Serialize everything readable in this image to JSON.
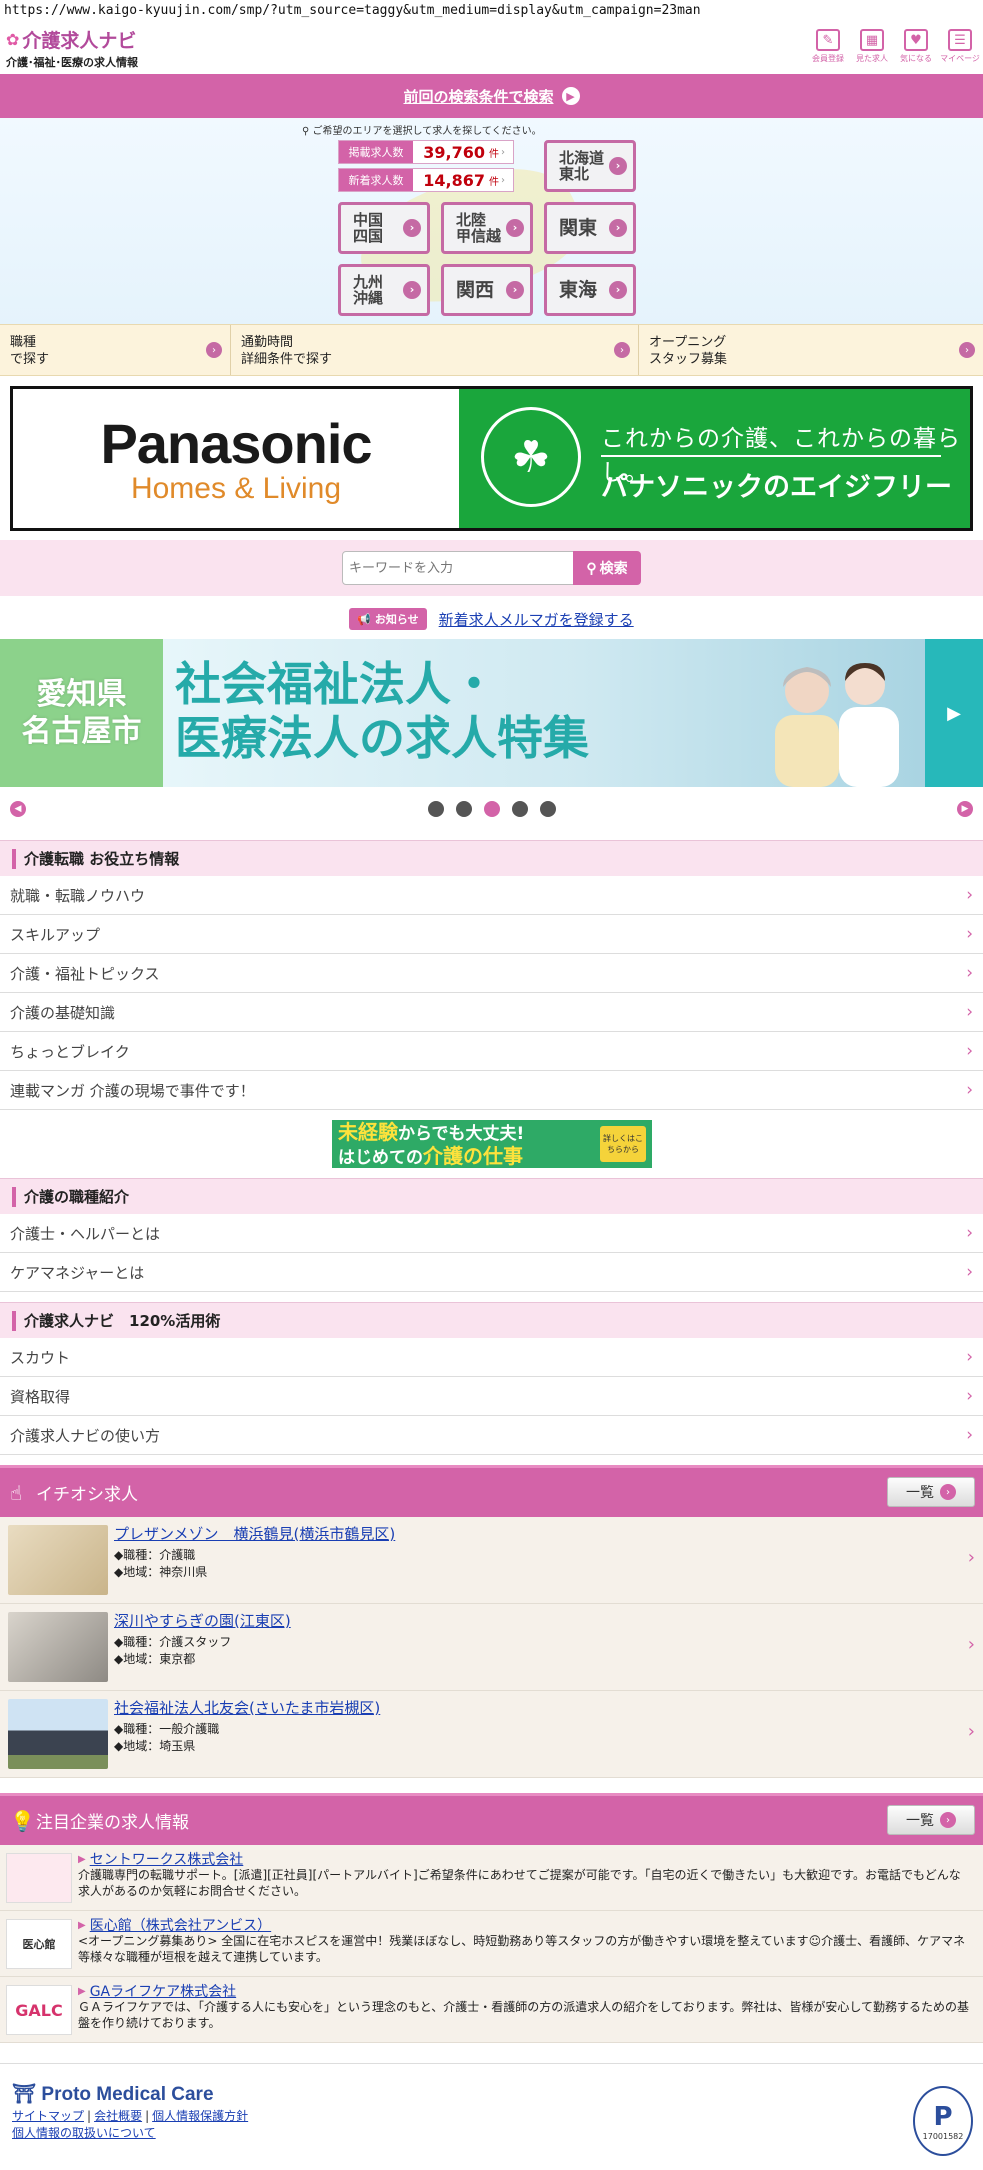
{
  "browser": {
    "url": "https://www.kaigo-kyuujin.com/smp/?utm_source=taggy&utm_medium=display&utm_campaign=23man"
  },
  "header": {
    "logo": "介護求人ナビ",
    "logo_sub": "介護･福祉･医療の求人情報",
    "icons": [
      {
        "name": "pencil-icon",
        "glyph": "✎",
        "label": "会員登録"
      },
      {
        "name": "calendar-icon",
        "glyph": "▦",
        "label": "見た求人"
      },
      {
        "name": "heart-icon",
        "glyph": "♥",
        "label": "気になる"
      },
      {
        "name": "mypage-icon",
        "glyph": "☰",
        "label": "マイページ"
      }
    ]
  },
  "prev_search": {
    "label": "前回の検索条件で検索"
  },
  "map": {
    "note": "ご希望のエリアを選択して求人を探してください。",
    "counts": [
      {
        "label": "掲載求人数",
        "value": "39,760",
        "unit": "件"
      },
      {
        "label": "新着求人数",
        "value": "14,867",
        "unit": "件"
      }
    ],
    "regions": [
      {
        "label": "北海道\n東北"
      },
      {
        "label": "中国\n四国"
      },
      {
        "label": "北陸\n甲信越"
      },
      {
        "label": "関東"
      },
      {
        "label": "九州\n沖縄"
      },
      {
        "label": "関西"
      },
      {
        "label": "東海"
      }
    ]
  },
  "conditions": [
    {
      "label": "職種\nで探す"
    },
    {
      "label": "通勤時間\n詳細条件で探す"
    },
    {
      "label": "オープニング\nスタッフ募集"
    }
  ],
  "pana_banner": {
    "brand": "Panasonic",
    "sub": "Homes & Living",
    "tagline": "これからの介護、これからの暮らし。",
    "name": "パナソニックのエイジフリー"
  },
  "search": {
    "placeholder": "キーワードを入力",
    "button": "検索"
  },
  "notice": {
    "badge": "お知らせ",
    "link": "新着求人メルマガを登録する"
  },
  "aichi_banner": {
    "left": "愛知県\n名古屋市",
    "title": "社会福祉法人・\n医療法人の求人特集"
  },
  "carousel": {
    "dots": 5,
    "active_index": 2
  },
  "sections": [
    {
      "title": "介護転職 お役立ち情報",
      "items": [
        "就職・転職ノウハウ",
        "スキルアップ",
        "介護・福祉トピックス",
        "介護の基礎知識",
        "ちょっとブレイク",
        "連載マンガ 介護の現場で事件です！"
      ]
    },
    {
      "title": "介護の職種紹介",
      "items": [
        "介護士・ヘルパーとは",
        "ケアマネジャーとは"
      ]
    },
    {
      "title": "介護求人ナビ　120%活用術",
      "items": [
        "スカウト",
        "資格取得",
        "介護求人ナビの使い方"
      ]
    }
  ],
  "mikeiken_banner": {
    "l1a": "未経験",
    "l1b": "からでも大丈夫!",
    "l2a": "はじめての",
    "l2b": "介護の仕事",
    "side": "詳しくはこちらから"
  },
  "pickup": {
    "title": "イチオシ求人",
    "more": "一覧",
    "items": [
      {
        "title": "プレザンメゾン　横浜鶴見(横浜市鶴見区)",
        "job": "◆職種：介護職",
        "area": "◆地域：神奈川県"
      },
      {
        "title": "深川やすらぎの園(江東区)",
        "job": "◆職種：介護スタッフ",
        "area": "◆地域：東京都"
      },
      {
        "title": "社会福祉法人北友会(さいたま市岩槻区)",
        "job": "◆職種：一般介護職",
        "area": "◆地域：埼玉県"
      }
    ]
  },
  "companies": {
    "title": "注目企業の求人情報",
    "more": "一覧",
    "items": [
      {
        "name": "セントワークス株式会社",
        "logo": "",
        "desc": "介護職専門の転職サポート。[派遣][正社員][パートアルバイト]ご希望条件にあわせてご提案が可能です。「自宅の近くで働きたい」も大歓迎です。お電話でもどんな求人があるのか気軽にお問合せください。"
      },
      {
        "name": "医心館（株式会社アンビス）",
        "logo": "医心館",
        "desc": "<オープニング募集あり> 全国に在宅ホスピスを運営中！残業ほぼなし、時短勤務あり等スタッフの方が働きやすい環境を整えています☺介護士、看護師、ケアマネ等様々な職種が垣根を越えて連携しています。"
      },
      {
        "name": "GAライフケア株式会社",
        "logo": "GALC",
        "desc": "ＧＡライフケアでは、「介護する人にも安心を」という理念のもと、介護士・看護師の方の派遣求人の紹介をしております。弊社は、皆様が安心して勤務するための基盤を作り続けております。"
      }
    ]
  },
  "footer": {
    "logo": "Proto Medical Care",
    "links": [
      "サイトマップ",
      "会社概要",
      "個人情報保護方針",
      "個人情報の取扱いについて"
    ],
    "privacy_mark": "P",
    "privacy_no": "17001582"
  },
  "colors": {
    "accent": "#d363a8",
    "link": "#1a3fb3",
    "count": "#c0000c",
    "banner_green": "#1aa63c"
  }
}
